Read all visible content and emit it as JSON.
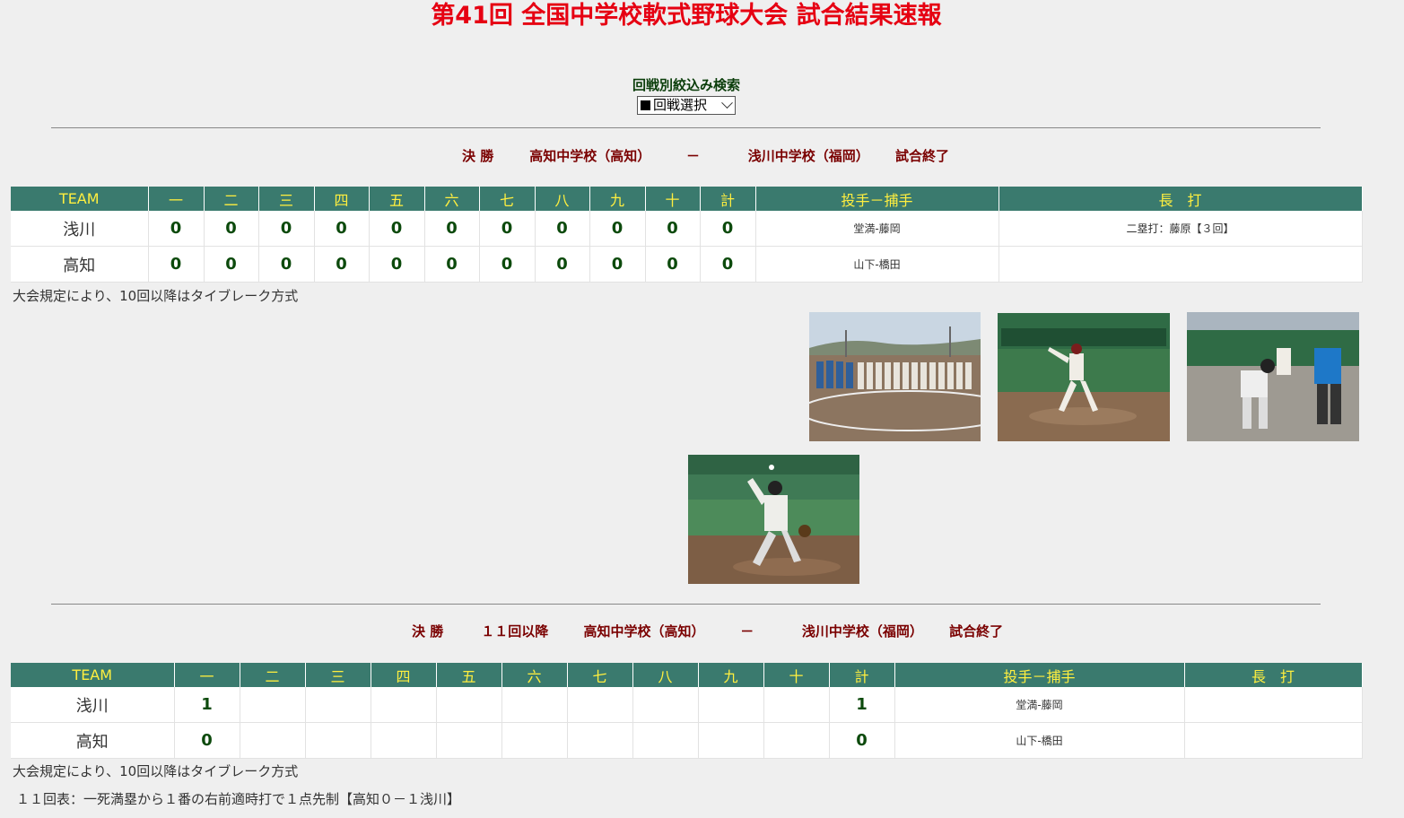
{
  "page": {
    "title": "第41回 全国中学校軟式野球大会 試合結果速報"
  },
  "filter": {
    "label": "回戦別絞込み検索",
    "select_value": "回戦選択"
  },
  "games": [
    {
      "round": "決 勝",
      "extra": "",
      "home": "高知中学校（高知）",
      "dash": "－",
      "away": "浅川中学校（福岡）",
      "status": "試合終了",
      "headers": {
        "team": "TEAM",
        "innings": [
          "一",
          "二",
          "三",
          "四",
          "五",
          "六",
          "七",
          "八",
          "九",
          "十"
        ],
        "total": "計",
        "battery": "投手－捕手",
        "hits": "長　打"
      },
      "rows": [
        {
          "team": "浅川",
          "innings": [
            "0",
            "0",
            "0",
            "0",
            "0",
            "0",
            "0",
            "0",
            "0",
            "0"
          ],
          "total": "0",
          "battery": "堂満-藤岡",
          "hits": "二塁打：藤原【３回】"
        },
        {
          "team": "高知",
          "innings": [
            "0",
            "0",
            "0",
            "0",
            "0",
            "0",
            "0",
            "0",
            "0",
            "0"
          ],
          "total": "0",
          "battery": "山下-橋田",
          "hits": ""
        }
      ],
      "note": "大会規定により、10回以降はタイブレーク方式",
      "photos": [
        "team-lineup-photo",
        "pitcher-photo",
        "home-plate-slide-photo",
        "pitcher-throw-photo"
      ]
    },
    {
      "round": "決 勝",
      "extra": "１１回以降",
      "home": "高知中学校（高知）",
      "dash": "－",
      "away": "浅川中学校（福岡）",
      "status": "試合終了",
      "headers": {
        "team": "TEAM",
        "innings": [
          "一",
          "二",
          "三",
          "四",
          "五",
          "六",
          "七",
          "八",
          "九",
          "十"
        ],
        "total": "計",
        "battery": "投手－捕手",
        "hits": "長　打"
      },
      "rows": [
        {
          "team": "浅川",
          "innings": [
            "1",
            "",
            "",
            "",
            "",
            "",
            "",
            "",
            "",
            ""
          ],
          "total": "1",
          "battery": "堂満-藤岡",
          "hits": ""
        },
        {
          "team": "高知",
          "innings": [
            "0",
            "",
            "",
            "",
            "",
            "",
            "",
            "",
            "",
            ""
          ],
          "total": "0",
          "battery": "山下-橋田",
          "hits": ""
        }
      ],
      "note": "大会規定により、10回以降はタイブレーク方式",
      "summary": "１１回表：一死満塁から１番の右前適時打で１点先制【高知０－１浅川】"
    }
  ]
}
